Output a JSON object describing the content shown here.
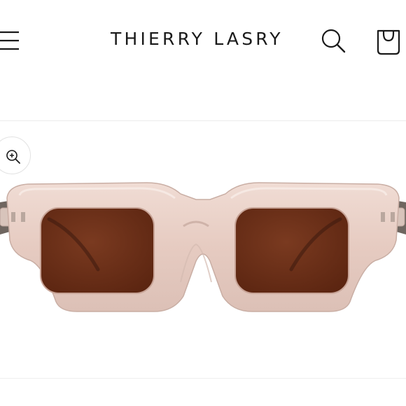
{
  "header": {
    "brand": "THIERRY LASRY",
    "menu_icon": "hamburger-menu-icon",
    "search_icon": "search-icon",
    "cart_icon": "shopping-bag-icon"
  },
  "gallery": {
    "zoom_icon": "zoom-in-icon",
    "product_image": "tinted-sunglasses-front-view"
  },
  "colors": {
    "text": "#1a1a1a",
    "frame": "#e9cfc6",
    "lens": "#6b2e18",
    "divider": "#ececec"
  }
}
